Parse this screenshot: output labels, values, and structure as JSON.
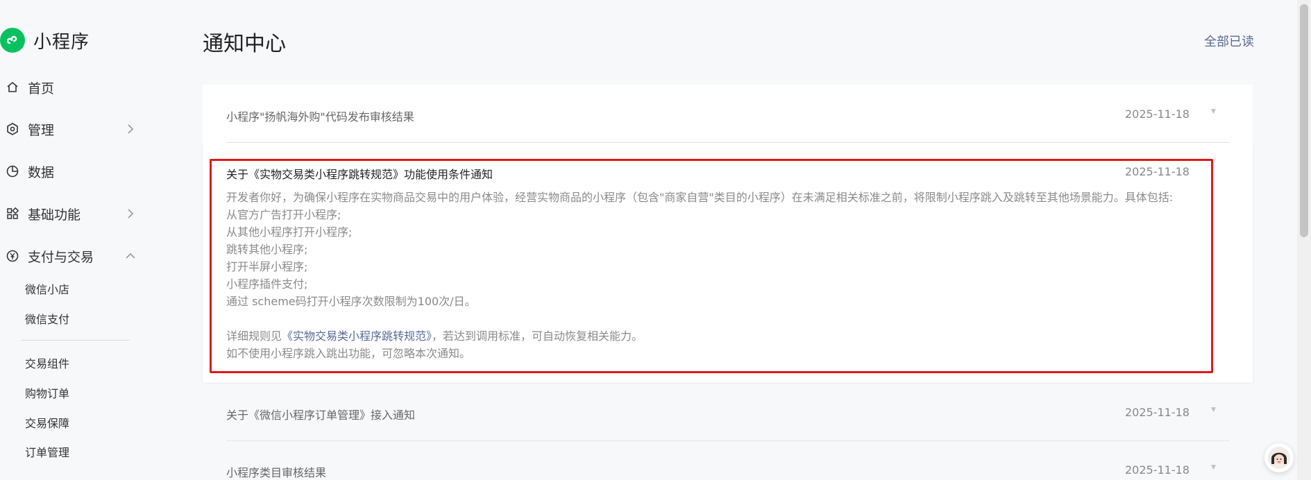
{
  "brand": {
    "name": "小程序",
    "logo_color": "#07c160"
  },
  "nav": {
    "home": "首页",
    "manage": "管理",
    "data": "数据",
    "basic": "基础功能",
    "pay": "支付与交易",
    "sub_group1": [
      "微信小店",
      "微信支付"
    ],
    "sub_group2": [
      "交易组件",
      "购物订单",
      "交易保障",
      "订单管理"
    ]
  },
  "header": {
    "title": "通知中心",
    "mark_all_read": "全部已读"
  },
  "notices": [
    {
      "title": "小程序\"扬帆海外购\"代码发布审核结果",
      "date": "2025-11-18"
    },
    {
      "title": "关于《实物交易类小程序跳转规范》功能使用条件通知",
      "date": "2025-11-18",
      "body_intro": "开发者你好，为确保小程序在实物商品交易中的用户体验，经营实物商品的小程序（包含\"商家自营\"类目的小程序）在未满足相关标准之前，将限制小程序跳入及跳转至其他场景能力。具体包括:",
      "body_items": [
        "从官方广告打开小程序;",
        "从其他小程序打开小程序;",
        "跳转其他小程序;",
        "打开半屏小程序;",
        "小程序插件支付;",
        "通过 scheme码打开小程序次数限制为100次/日。"
      ],
      "rule_prefix": "详细规则见",
      "rule_link": "《实物交易类小程序跳转规范》",
      "rule_suffix": "，若达到调用标准，可自动恢复相关能力。",
      "ignore_note": "如不使用小程序跳入跳出功能，可忽略本次通知。"
    },
    {
      "title": "关于《微信小程序订单管理》接入通知",
      "date": "2025-11-18"
    },
    {
      "title": "小程序类目审核结果",
      "date": "2025-11-18"
    }
  ],
  "colors": {
    "link": "#576b95",
    "highlight": "#e31818"
  }
}
